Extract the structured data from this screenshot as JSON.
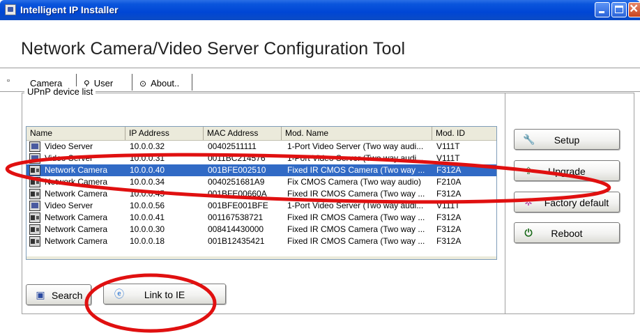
{
  "window": {
    "title": "Intelligent IP Installer"
  },
  "app": {
    "heading": "Network Camera/Video Server Configuration Tool"
  },
  "tabs": [
    {
      "label": "Camera",
      "icon": "camera-icon",
      "active": true
    },
    {
      "label": "User",
      "icon": "user-icon",
      "active": false
    },
    {
      "label": "About..",
      "icon": "info-icon",
      "active": false
    }
  ],
  "device_list": {
    "label": "UPnP device list",
    "columns": [
      "Name",
      "IP Address",
      "MAC Address",
      "Mod. Name",
      "Mod. ID"
    ],
    "rows": [
      {
        "icon": "video-server-icon",
        "name": "Video Server",
        "ip": "10.0.0.32",
        "mac": "00402511111",
        "model_name": "1-Port Video Server (Two way audi...",
        "model_id": "V111T",
        "selected": false
      },
      {
        "icon": "video-server-icon",
        "name": "Video Server",
        "ip": "10.0.0.31",
        "mac": "0011BC214576",
        "model_name": "1-Port Video Server (Two way audi...",
        "model_id": "V111T",
        "selected": false
      },
      {
        "icon": "network-camera-icon",
        "name": "Network Camera",
        "ip": "10.0.0.40",
        "mac": "001BFE002510",
        "model_name": "Fixed IR CMOS Camera (Two way ...",
        "model_id": "F312A",
        "selected": true
      },
      {
        "icon": "network-camera-icon",
        "name": "Network Camera",
        "ip": "10.0.0.34",
        "mac": "0040251681A9",
        "model_name": "Fix CMOS Camera (Two way audio)",
        "model_id": "F210A",
        "selected": false
      },
      {
        "icon": "network-camera-icon",
        "name": "Network Camera",
        "ip": "10.0.0.45",
        "mac": "001BFE00660A",
        "model_name": "Fixed IR CMOS Camera (Two way ...",
        "model_id": "F312A",
        "selected": false
      },
      {
        "icon": "video-server-icon",
        "name": "Video Server",
        "ip": "10.0.0.56",
        "mac": "001BFE001BFE",
        "model_name": "1-Port Video Server (Two way audi...",
        "model_id": "V111T",
        "selected": false
      },
      {
        "icon": "network-camera-icon",
        "name": "Network Camera",
        "ip": "10.0.0.41",
        "mac": "001167538721",
        "model_name": "Fixed IR CMOS Camera (Two way ...",
        "model_id": "F312A",
        "selected": false
      },
      {
        "icon": "network-camera-icon",
        "name": "Network Camera",
        "ip": "10.0.0.30",
        "mac": "008414430000",
        "model_name": "Fixed IR CMOS Camera (Two way ...",
        "model_id": "F312A",
        "selected": false
      },
      {
        "icon": "network-camera-icon",
        "name": "Network Camera",
        "ip": "10.0.0.18",
        "mac": "001B12435421",
        "model_name": "Fixed IR CMOS Camera (Two way ...",
        "model_id": "F312A",
        "selected": false
      }
    ]
  },
  "side_buttons": [
    {
      "label": "Setup",
      "icon": "wrench-icon"
    },
    {
      "label": "Upgrade",
      "icon": "upgrade-icon"
    },
    {
      "label": "Factory default",
      "icon": "factory-default-icon"
    },
    {
      "label": "Reboot",
      "icon": "power-icon"
    }
  ],
  "bottom_buttons": {
    "search": {
      "label": "Search",
      "icon": "search-icon"
    },
    "link_ie": {
      "label": "Link to IE",
      "icon": "internet-explorer-icon"
    }
  },
  "colors": {
    "titlebar": "#0a55dc",
    "selection": "#316ac5",
    "annotation": "#e01010"
  }
}
